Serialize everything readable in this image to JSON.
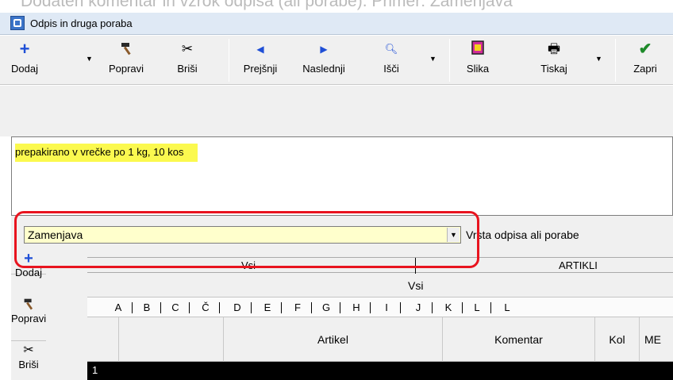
{
  "banner_text": "Dodaten komentar in vzrok odpisa (ali porabe). Primer: Zamenjava",
  "window": {
    "title": "Odpis in druga poraba"
  },
  "toolbar": {
    "dodaj": "Dodaj",
    "popravi": "Popravi",
    "brisi": "Briši",
    "prejsnji": "Prejšnji",
    "naslednji": "Naslednji",
    "isci": "Išči",
    "slika": "Slika",
    "tiskaj": "Tiskaj",
    "zapri": "Zapri"
  },
  "comment": {
    "text": "prepakirano v vrečke po 1 kg, 10 kos"
  },
  "type_combo": {
    "value": "Zamenjava",
    "label": "Vrsta odpisa ali porabe"
  },
  "side_toolbar": {
    "dodaj": "Dodaj",
    "popravi": "Popravi",
    "brisi": "Briši"
  },
  "grid": {
    "tabs": [
      "Vsi",
      "ARTIKLI"
    ],
    "filter_label": "Vsi",
    "letters": [
      "A",
      "B",
      "C",
      "Č",
      "D",
      "E",
      "F",
      "G",
      "H",
      "I",
      "J",
      "K",
      "L",
      "L"
    ],
    "columns": [
      "",
      "Artikel",
      "Komentar",
      "Kol",
      "ME"
    ],
    "first_row_number": "1"
  },
  "colors": {
    "comment_highlight": "#fbf94f",
    "combo_bg": "#ffffcc",
    "annotation_border": "#e8141f"
  }
}
